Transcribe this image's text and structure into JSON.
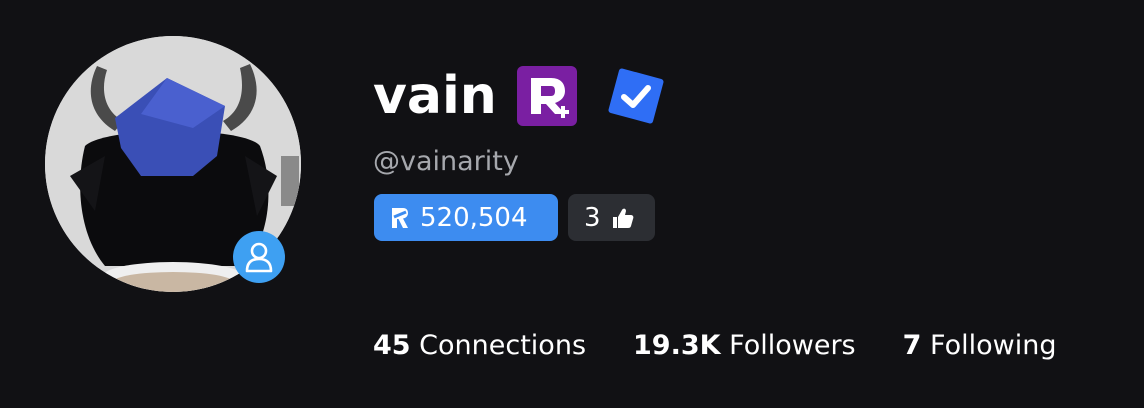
{
  "profile": {
    "display_name": "vain",
    "username": "@vainarity",
    "premium_icon": "roblox-premium-icon",
    "verified_icon": "verified-check-icon",
    "presence_icon": "user-presence-icon"
  },
  "robux": {
    "icon": "robux-icon",
    "value": "520,504"
  },
  "likes": {
    "value": "3",
    "icon": "thumbs-up-icon"
  },
  "stats": [
    {
      "number": "45",
      "label": "Connections"
    },
    {
      "number": "19.3K",
      "label": "Followers"
    },
    {
      "number": "7",
      "label": "Following"
    }
  ],
  "colors": {
    "background": "#111114",
    "robux_pill": "#3d8cf0",
    "likes_pill": "#2c2e33",
    "premium": "#7a1fa2",
    "verified": "#2f6ef5",
    "presence_badge": "#3ea0f2",
    "username": "#a6a8ad"
  }
}
